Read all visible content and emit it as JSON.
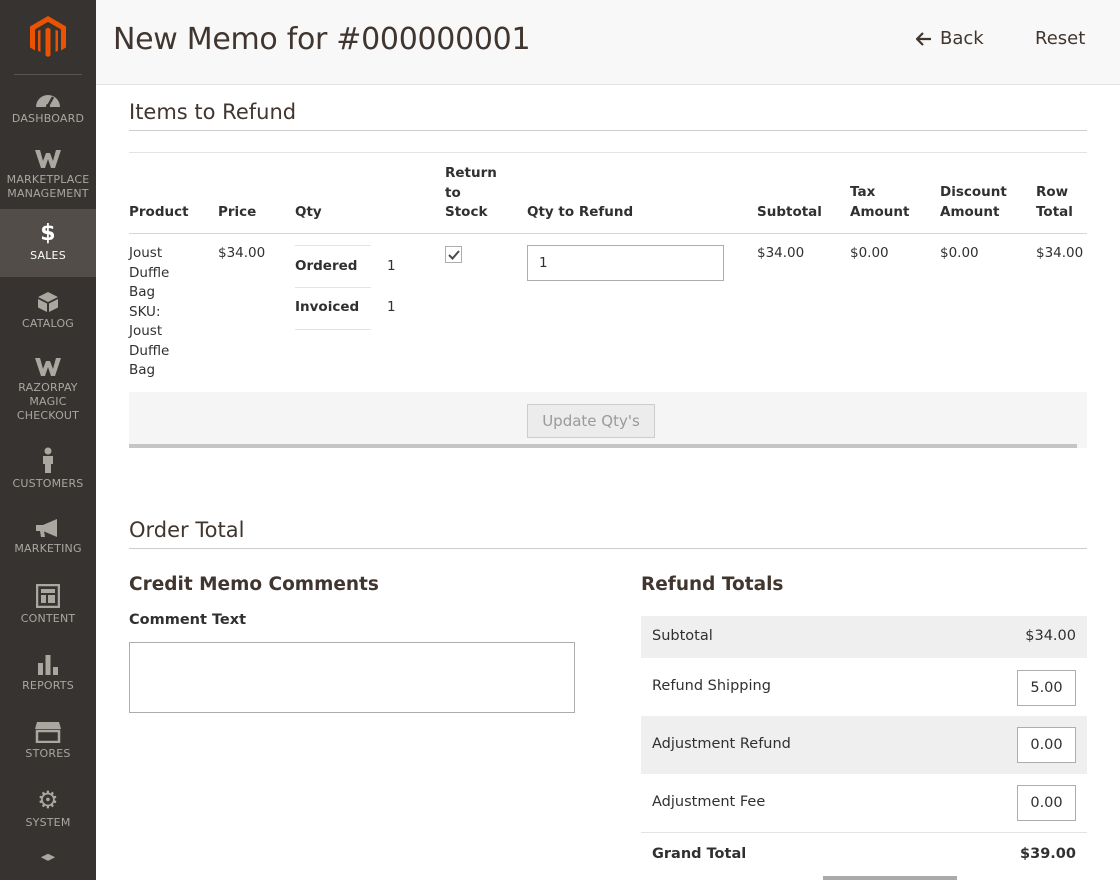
{
  "sidebar": {
    "items": [
      {
        "label": "DASHBOARD",
        "icon": "dashboard-icon"
      },
      {
        "label": "MARKETPLACE MANAGEMENT",
        "icon": "marketplace-icon"
      },
      {
        "label": "SALES",
        "icon": "dollar-icon"
      },
      {
        "label": "CATALOG",
        "icon": "box-icon"
      },
      {
        "label": "RAZORPAY MAGIC CHECKOUT",
        "icon": "razorpay-icon"
      },
      {
        "label": "CUSTOMERS",
        "icon": "person-icon"
      },
      {
        "label": "MARKETING",
        "icon": "megaphone-icon"
      },
      {
        "label": "CONTENT",
        "icon": "layout-icon"
      },
      {
        "label": "REPORTS",
        "icon": "bar-chart-icon"
      },
      {
        "label": "STORES",
        "icon": "storefront-icon"
      },
      {
        "label": "SYSTEM",
        "icon": "gear-icon"
      }
    ],
    "active": "SALES"
  },
  "header": {
    "title": "New Memo for #000000001",
    "back_label": "Back",
    "reset_label": "Reset"
  },
  "items_section": {
    "title": "Items to Refund",
    "columns": [
      "Product",
      "Price",
      "Qty",
      "Return to Stock",
      "Qty to Refund",
      "Subtotal",
      "Tax Amount",
      "Discount Amount",
      "Row Total"
    ],
    "row": {
      "product": "Joust Duffle Bag",
      "sku_label": "SKU:",
      "sku": "Joust Duffle Bag",
      "price": "$34.00",
      "ordered_label": "Ordered",
      "ordered_value": "1",
      "invoiced_label": "Invoiced",
      "invoiced_value": "1",
      "return_to_stock": true,
      "qty_to_refund": "1",
      "subtotal": "$34.00",
      "tax_amount": "$0.00",
      "discount_amount": "$0.00",
      "row_total": "$34.00"
    },
    "update_button": "Update Qty's"
  },
  "order_total": {
    "title": "Order Total",
    "comments_title": "Credit Memo Comments",
    "comment_label": "Comment Text",
    "comment_value": "",
    "refund_totals_title": "Refund Totals",
    "subtotal_label": "Subtotal",
    "subtotal_value": "$34.00",
    "refund_shipping_label": "Refund Shipping",
    "refund_shipping_value": "5.00",
    "adjustment_refund_label": "Adjustment Refund",
    "adjustment_refund_value": "0.00",
    "adjustment_fee_label": "Adjustment Fee",
    "adjustment_fee_value": "0.00",
    "grand_total_label": "Grand Total",
    "grand_total_value": "$39.00"
  },
  "colors": {
    "sidebar_bg": "#373330",
    "sidebar_active": "#524d49",
    "logo_orange": "#eb5202",
    "title_text": "#41362f"
  }
}
